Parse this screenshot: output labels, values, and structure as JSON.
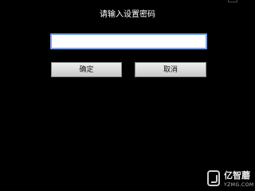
{
  "dialog": {
    "title": "请输入设置密码",
    "password_value": "",
    "ok_label": "确定",
    "cancel_label": "取消"
  },
  "watermark": {
    "name": "亿智蘑",
    "domain": "YZMG.COM"
  }
}
